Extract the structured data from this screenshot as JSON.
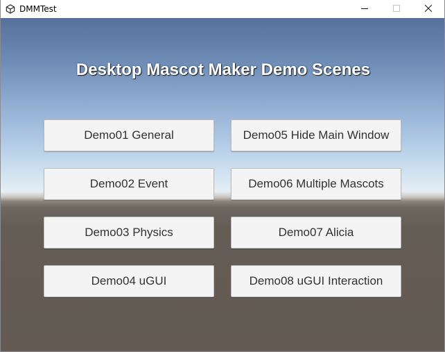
{
  "window": {
    "title": "DMMTest",
    "app_icon": "unity-icon",
    "controls": {
      "minimize_icon": "minimize-icon",
      "maximize_icon": "maximize-icon",
      "close_icon": "close-icon"
    }
  },
  "scene": {
    "title": "Desktop Mascot Maker Demo Scenes",
    "buttons": {
      "demo01": "Demo01 General",
      "demo02": "Demo02 Event",
      "demo03": "Demo03 Physics",
      "demo04": "Demo04 uGUI",
      "demo05": "Demo05 Hide Main Window",
      "demo06": "Demo06 Multiple Mascots",
      "demo07": "Demo07 Alicia",
      "demo08": "Demo08 uGUI Interaction"
    }
  },
  "colors": {
    "sky_top": "#57709b",
    "horizon": "#e6eef3",
    "ground": "#635b54",
    "button_bg": "#f4f4f4",
    "button_text": "#323232"
  }
}
